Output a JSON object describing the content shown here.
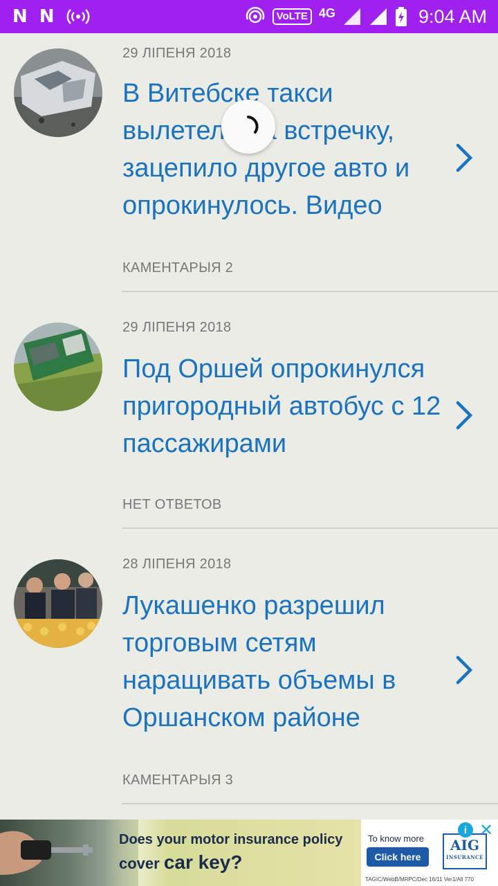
{
  "status_bar": {
    "time": "9:04 AM",
    "network": "4G",
    "volte": "VoLTE",
    "notification_glyph": "N",
    "icons": [
      "n-logo-icon",
      "n-logo-icon",
      "hotspot-icon",
      "wifi-calling-icon",
      "signal-icon",
      "signal-icon",
      "battery-charging-icon"
    ]
  },
  "articles": [
    {
      "date": "29 ЛІПЕНЯ 2018",
      "title": "В Витебске такси вылетело на встречку, зацепило другое авто и опрокинулось. Видео",
      "comments": "КАМЕНТАРЫЯ 2"
    },
    {
      "date": "29 ЛІПЕНЯ 2018",
      "title": "Под Оршей опрокинулся пригородный автобус с 12 пассажирами",
      "comments": "НЕТ ОТВЕТОВ"
    },
    {
      "date": "28 ЛІПЕНЯ 2018",
      "title": "Лукашенко разрешил торговым сетям наращивать объемы в Оршанском районе",
      "comments": "КАМЕНТАРЫЯ 3"
    }
  ],
  "ad": {
    "line1": "Does your motor insurance policy",
    "line2_prefix": "cover ",
    "line2_emphasis": "car key?",
    "know_more": "To know more",
    "cta": "Click here",
    "brand": "AIG",
    "brand_sub": "INSURANCE",
    "fine_print": "TAGIC/WebB/MRPC/Dec 16/11 Ver1/All 770",
    "info": "i",
    "close": "✕"
  },
  "colors": {
    "status_bar": "#a020f0",
    "title": "#1a72c2",
    "background": "#ecece7",
    "meta_text": "#777777"
  }
}
